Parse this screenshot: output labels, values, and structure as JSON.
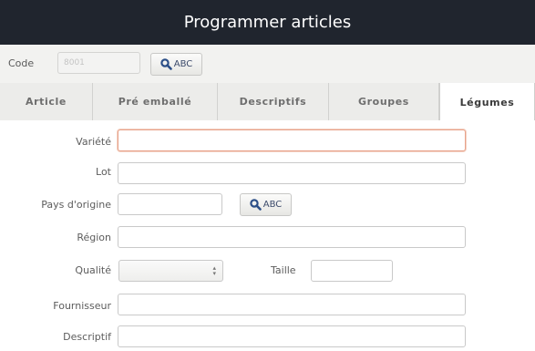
{
  "window": {
    "title": "Programmer articles"
  },
  "toolbar": {
    "code_label": "Code",
    "code_value": "8001",
    "abc_label": "ABC"
  },
  "tabs": [
    {
      "label": "Article",
      "active": false
    },
    {
      "label": "Pré emballé",
      "active": false
    },
    {
      "label": "Descriptifs",
      "active": false
    },
    {
      "label": "Groupes",
      "active": false
    },
    {
      "label": "Légumes",
      "active": true
    }
  ],
  "form": {
    "variete": {
      "label": "Variété",
      "value": ""
    },
    "lot": {
      "label": "Lot",
      "value": ""
    },
    "pays": {
      "label": "Pays d'origine",
      "value": "",
      "abc_label": "ABC"
    },
    "region": {
      "label": "Région",
      "value": ""
    },
    "qualite": {
      "label": "Qualité",
      "value": ""
    },
    "taille": {
      "label": "Taille",
      "value": ""
    },
    "fournisseur": {
      "label": "Fournisseur",
      "value": ""
    },
    "descriptif": {
      "label": "Descriptif",
      "value": ""
    }
  },
  "colors": {
    "titlebar": "#20252e",
    "focus_border": "#e8a28a",
    "search_icon": "#2c4f88"
  },
  "icons": {
    "search": "magnifier-icon"
  }
}
